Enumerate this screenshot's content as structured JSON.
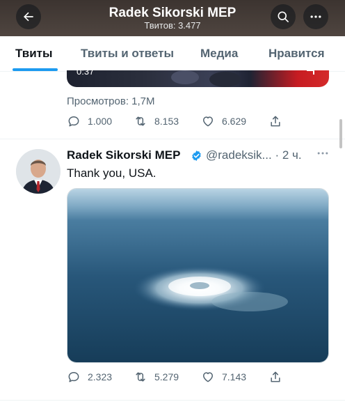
{
  "header": {
    "title": "Radek Sikorski MEP",
    "subtitle": "Твитов: 3.477",
    "back_icon": "arrow-left-icon",
    "search_icon": "search-icon",
    "more_icon": "more-horizontal-icon"
  },
  "tabs": [
    {
      "label": "Твиты",
      "active": true
    },
    {
      "label": "Твиты и ответы",
      "active": false
    },
    {
      "label": "Медиа",
      "active": false
    },
    {
      "label": "Нравится",
      "active": false
    }
  ],
  "previous_tweet": {
    "video_time": "0:37",
    "views": "Просмотров: 1,7M",
    "actions": {
      "replies": "1.000",
      "retweets": "8.153",
      "likes": "6.629"
    }
  },
  "tweet": {
    "author_name": "Radek Sikorski MEP",
    "handle": "@radeksik... · 2 ч.",
    "text": "Thank you, USA.",
    "verified": true,
    "actions": {
      "replies": "2.323",
      "retweets": "5.279",
      "likes": "7.143"
    }
  },
  "colors": {
    "accent": "#1d9bf0",
    "header_bg": "#463c37",
    "muted_text": "#536471",
    "sea": "#1f4a66"
  }
}
